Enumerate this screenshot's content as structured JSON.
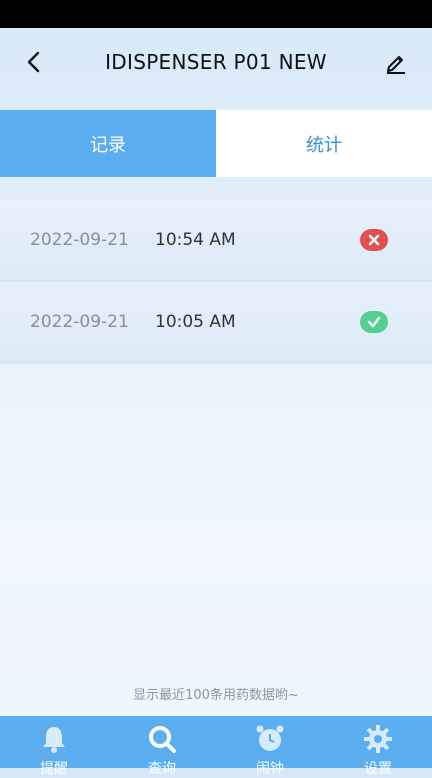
{
  "header": {
    "title": "IDISPENSER P01 NEW",
    "back_icon": "chevron-left-icon",
    "edit_icon": "pencil-icon"
  },
  "tabs": [
    {
      "label": "记录",
      "active": true
    },
    {
      "label": "统计",
      "active": false
    }
  ],
  "records": [
    {
      "date": "2022-09-21",
      "time": "10:54 AM",
      "status": "failed",
      "status_icon": "x-icon"
    },
    {
      "date": "2022-09-21",
      "time": "10:05 AM",
      "status": "success",
      "status_icon": "check-icon"
    }
  ],
  "footer_note": "显示最近100条用药数据哟~",
  "bottom_nav": [
    {
      "label": "提醒",
      "icon": "bell-icon"
    },
    {
      "label": "查询",
      "icon": "search-icon"
    },
    {
      "label": "闹钟",
      "icon": "alarm-clock-icon"
    },
    {
      "label": "设置",
      "icon": "gear-icon"
    }
  ],
  "colors": {
    "accent": "#5aaef0",
    "status_fail": "#e35050",
    "status_ok": "#55cf8e"
  }
}
